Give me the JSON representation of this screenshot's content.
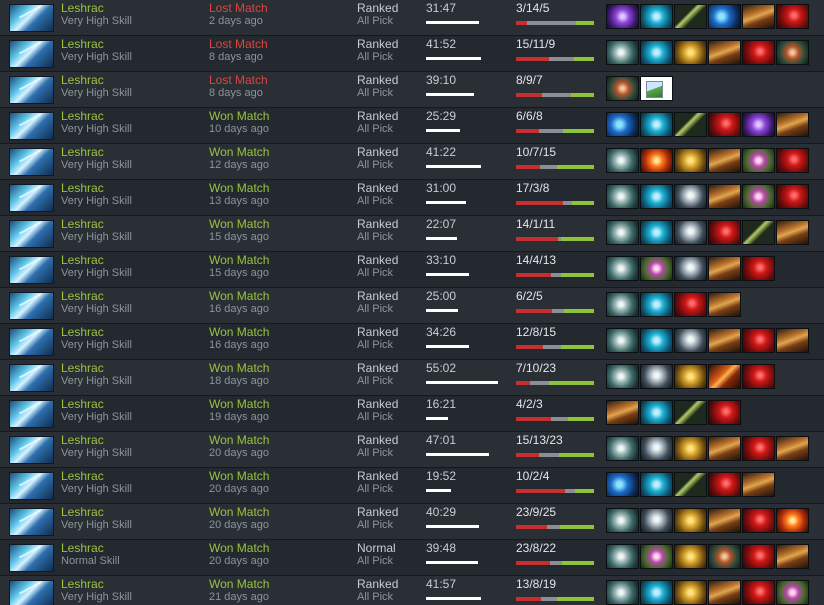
{
  "matches": [
    {
      "hero": "Leshrac",
      "skill": "Very High Skill",
      "result": "Lost Match",
      "outcome": "lost",
      "ago": "2 days ago",
      "lobby": "Ranked",
      "mode": "All Pick",
      "duration": "31:47",
      "duration_fraction": 0.73,
      "kda": "3/14/5",
      "k": 3,
      "d": 14,
      "a": 5,
      "items": [
        "purple-icon",
        "blink-icon",
        "staff-icon",
        "blue-icon",
        "boots-icon",
        "red-icon"
      ]
    },
    {
      "hero": "Leshrac",
      "skill": "Very High Skill",
      "result": "Lost Match",
      "outcome": "lost",
      "ago": "8 days ago",
      "lobby": "Ranked",
      "mode": "All Pick",
      "duration": "41:52",
      "duration_fraction": 0.77,
      "kda": "15/11/9",
      "k": 15,
      "d": 11,
      "a": 9,
      "items": [
        "aeon-icon",
        "blink-icon",
        "gold-icon",
        "boots-icon",
        "red-icon",
        "mech-icon"
      ]
    },
    {
      "hero": "Leshrac",
      "skill": "Very High Skill",
      "result": "Lost Match",
      "outcome": "lost",
      "ago": "8 days ago",
      "lobby": "Ranked",
      "mode": "All Pick",
      "duration": "39:10",
      "duration_fraction": 0.67,
      "kda": "8/9/7",
      "k": 8,
      "d": 9,
      "a": 7,
      "items": [
        "mech-icon",
        "broken-image-icon"
      ]
    },
    {
      "hero": "Leshrac",
      "skill": "Very High Skill",
      "result": "Won Match",
      "outcome": "won",
      "ago": "10 days ago",
      "lobby": "Ranked",
      "mode": "All Pick",
      "duration": "25:29",
      "duration_fraction": 0.47,
      "kda": "6/6/8",
      "k": 6,
      "d": 6,
      "a": 8,
      "items": [
        "blue-icon",
        "blink-icon",
        "staff-icon",
        "red-icon",
        "purple-icon",
        "boots-icon"
      ]
    },
    {
      "hero": "Leshrac",
      "skill": "Very High Skill",
      "result": "Won Match",
      "outcome": "won",
      "ago": "12 days ago",
      "lobby": "Ranked",
      "mode": "All Pick",
      "duration": "41:22",
      "duration_fraction": 0.76,
      "kda": "10/7/15",
      "k": 10,
      "d": 7,
      "a": 15,
      "items": [
        "aeon-icon",
        "fire-icon",
        "gold-icon",
        "boots-icon",
        "orb-icon",
        "red-icon"
      ]
    },
    {
      "hero": "Leshrac",
      "skill": "Very High Skill",
      "result": "Won Match",
      "outcome": "won",
      "ago": "13 days ago",
      "lobby": "Ranked",
      "mode": "All Pick",
      "duration": "31:00",
      "duration_fraction": 0.56,
      "kda": "17/3/8",
      "k": 17,
      "d": 3,
      "a": 8,
      "items": [
        "aeon-icon",
        "blink-icon",
        "skull-icon",
        "boots-icon",
        "orb-icon",
        "red-icon"
      ]
    },
    {
      "hero": "Leshrac",
      "skill": "Very High Skill",
      "result": "Won Match",
      "outcome": "won",
      "ago": "15 days ago",
      "lobby": "Ranked",
      "mode": "All Pick",
      "duration": "22:07",
      "duration_fraction": 0.43,
      "kda": "14/1/11",
      "k": 14,
      "d": 1,
      "a": 11,
      "items": [
        "aeon-icon",
        "blink-icon",
        "skull-icon",
        "red-icon",
        "staff-icon",
        "boots-icon"
      ]
    },
    {
      "hero": "Leshrac",
      "skill": "Very High Skill",
      "result": "Won Match",
      "outcome": "won",
      "ago": "15 days ago",
      "lobby": "Ranked",
      "mode": "All Pick",
      "duration": "33:10",
      "duration_fraction": 0.6,
      "kda": "14/4/13",
      "k": 14,
      "d": 4,
      "a": 13,
      "items": [
        "aeon-icon",
        "orb-icon",
        "skull-icon",
        "boots-icon",
        "red-icon"
      ]
    },
    {
      "hero": "Leshrac",
      "skill": "Very High Skill",
      "result": "Won Match",
      "outcome": "won",
      "ago": "16 days ago",
      "lobby": "Ranked",
      "mode": "All Pick",
      "duration": "25:00",
      "duration_fraction": 0.45,
      "kda": "6/2/5",
      "k": 6,
      "d": 2,
      "a": 5,
      "items": [
        "aeon-icon",
        "blink-icon",
        "red-icon",
        "boots-icon"
      ]
    },
    {
      "hero": "Leshrac",
      "skill": "Very High Skill",
      "result": "Won Match",
      "outcome": "won",
      "ago": "16 days ago",
      "lobby": "Ranked",
      "mode": "All Pick",
      "duration": "34:26",
      "duration_fraction": 0.6,
      "kda": "12/8/15",
      "k": 12,
      "d": 8,
      "a": 15,
      "items": [
        "aeon-icon",
        "blink-icon",
        "skull-icon",
        "boots-icon",
        "red-icon",
        "boots-icon"
      ]
    },
    {
      "hero": "Leshrac",
      "skill": "Very High Skill",
      "result": "Won Match",
      "outcome": "won",
      "ago": "18 days ago",
      "lobby": "Ranked",
      "mode": "All Pick",
      "duration": "55:02",
      "duration_fraction": 1.0,
      "kda": "7/10/23",
      "k": 7,
      "d": 10,
      "a": 23,
      "items": [
        "aeon-icon",
        "skull-icon",
        "gold-icon",
        "ember-icon",
        "red-icon"
      ]
    },
    {
      "hero": "Leshrac",
      "skill": "Very High Skill",
      "result": "Won Match",
      "outcome": "won",
      "ago": "19 days ago",
      "lobby": "Ranked",
      "mode": "All Pick",
      "duration": "16:21",
      "duration_fraction": 0.3,
      "kda": "4/2/3",
      "k": 4,
      "d": 2,
      "a": 3,
      "items": [
        "boots-icon",
        "blink-icon",
        "staff-icon",
        "red-icon"
      ]
    },
    {
      "hero": "Leshrac",
      "skill": "Very High Skill",
      "result": "Won Match",
      "outcome": "won",
      "ago": "20 days ago",
      "lobby": "Ranked",
      "mode": "All Pick",
      "duration": "47:01",
      "duration_fraction": 0.87,
      "kda": "15/13/23",
      "k": 15,
      "d": 13,
      "a": 23,
      "items": [
        "aeon-icon",
        "skull-icon",
        "gold-icon",
        "boots-icon",
        "red-icon",
        "boots-icon"
      ]
    },
    {
      "hero": "Leshrac",
      "skill": "Very High Skill",
      "result": "Won Match",
      "outcome": "won",
      "ago": "20 days ago",
      "lobby": "Ranked",
      "mode": "All Pick",
      "duration": "19:52",
      "duration_fraction": 0.35,
      "kda": "10/2/4",
      "k": 10,
      "d": 2,
      "a": 4,
      "items": [
        "blue-icon",
        "blink-icon",
        "staff-icon",
        "red-icon",
        "boots-icon"
      ]
    },
    {
      "hero": "Leshrac",
      "skill": "Very High Skill",
      "result": "Won Match",
      "outcome": "won",
      "ago": "20 days ago",
      "lobby": "Ranked",
      "mode": "All Pick",
      "duration": "40:29",
      "duration_fraction": 0.74,
      "kda": "23/9/25",
      "k": 23,
      "d": 9,
      "a": 25,
      "items": [
        "aeon-icon",
        "skull-icon",
        "gold-icon",
        "boots-icon",
        "red-icon",
        "fire-icon"
      ]
    },
    {
      "hero": "Leshrac",
      "skill": "Normal Skill",
      "result": "Won Match",
      "outcome": "won",
      "ago": "20 days ago",
      "lobby": "Normal",
      "mode": "All Pick",
      "duration": "39:48",
      "duration_fraction": 0.72,
      "kda": "23/8/22",
      "k": 23,
      "d": 8,
      "a": 22,
      "items": [
        "aeon-icon",
        "orb-icon",
        "gold-icon",
        "mech-icon",
        "red-icon",
        "boots-icon"
      ]
    },
    {
      "hero": "Leshrac",
      "skill": "Very High Skill",
      "result": "Won Match",
      "outcome": "won",
      "ago": "21 days ago",
      "lobby": "Ranked",
      "mode": "All Pick",
      "duration": "41:57",
      "duration_fraction": 0.77,
      "kda": "13/8/19",
      "k": 13,
      "d": 8,
      "a": 19,
      "items": [
        "aeon-icon",
        "blink-icon",
        "gold-icon",
        "boots-icon",
        "red-icon",
        "orb-icon"
      ]
    }
  ]
}
